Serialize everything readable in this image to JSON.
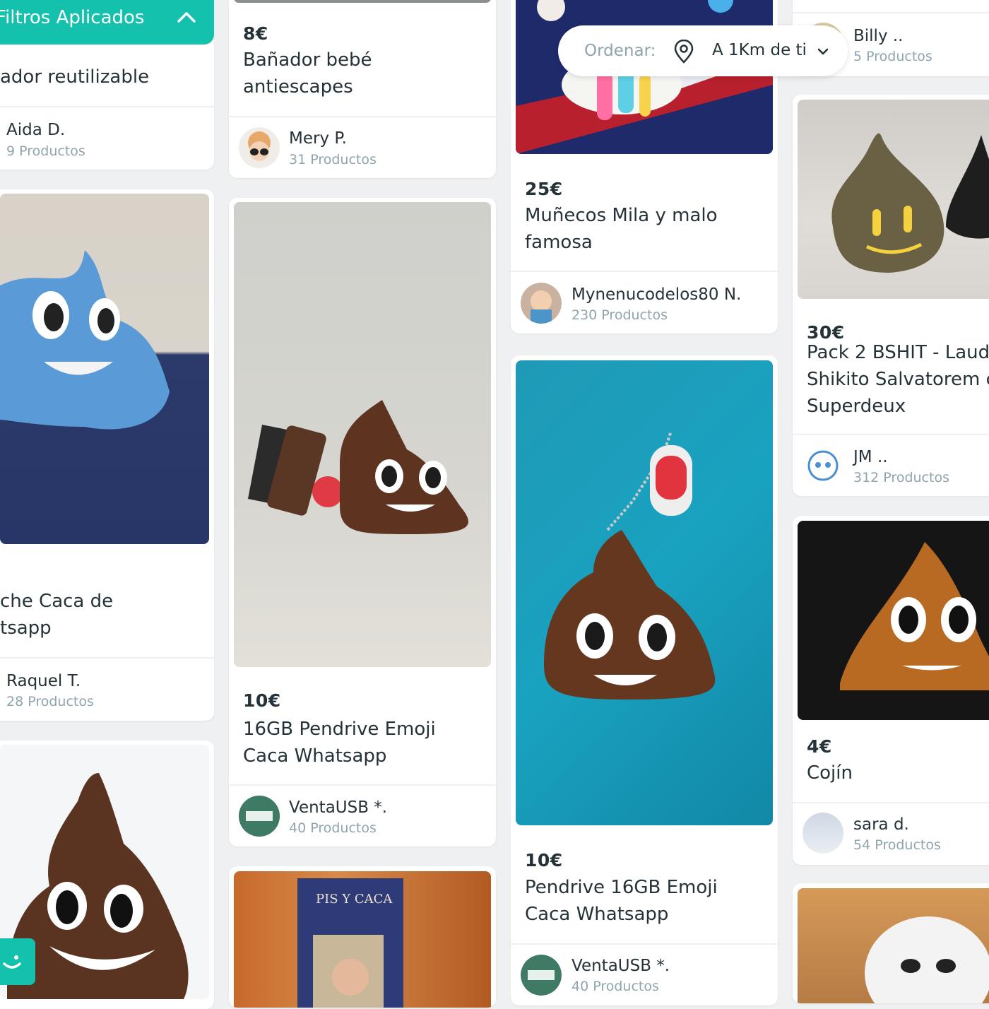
{
  "filters": {
    "label": "Filtros Aplicados"
  },
  "sort": {
    "label": "Ordenar:",
    "value": "A 1Km de ti"
  },
  "cards": [
    {
      "title": "ador reutilizable",
      "seller": "Aida D.",
      "count": "9 Productos"
    },
    {
      "price": "8€",
      "title_line1": "Bañador bebé",
      "title_line2": "antiescapes",
      "seller": "Mery P.",
      "count": "31 Productos"
    },
    {
      "price": "25€",
      "title_line1": "Muñecos Mila y malo",
      "title_line2": "famosa",
      "seller": "Mynenucodelos80 N.",
      "count": "230 Productos"
    },
    {
      "seller": "Billy ..",
      "count": "5 Productos"
    },
    {
      "title_line1": "che Caca de",
      "title_line2": "tsapp",
      "seller": "Raquel T.",
      "count": "28 Productos"
    },
    {
      "price": "10€",
      "title_line1": "16GB Pendrive Emoji",
      "title_line2": "Caca Whatsapp",
      "seller": "VentaUSB *.",
      "count": "40 Productos"
    },
    {
      "price": "10€",
      "title_line1": "Pendrive 16GB Emoji",
      "title_line2": "Caca Whatsapp",
      "seller": "VentaUSB *.",
      "count": "40 Productos"
    },
    {
      "price": "30€",
      "title_line1": "Pack 2 BSHIT - Laud",
      "title_line2": "Shikito Salvatorem c",
      "title_line3": "Superdeux",
      "seller": "JM ..",
      "count": "312 Productos"
    },
    {
      "price": "4€",
      "title_line1": "Cojín",
      "seller": "sara d.",
      "count": "54 Productos"
    },
    {
      "book_title": "PIS Y CACA"
    }
  ]
}
